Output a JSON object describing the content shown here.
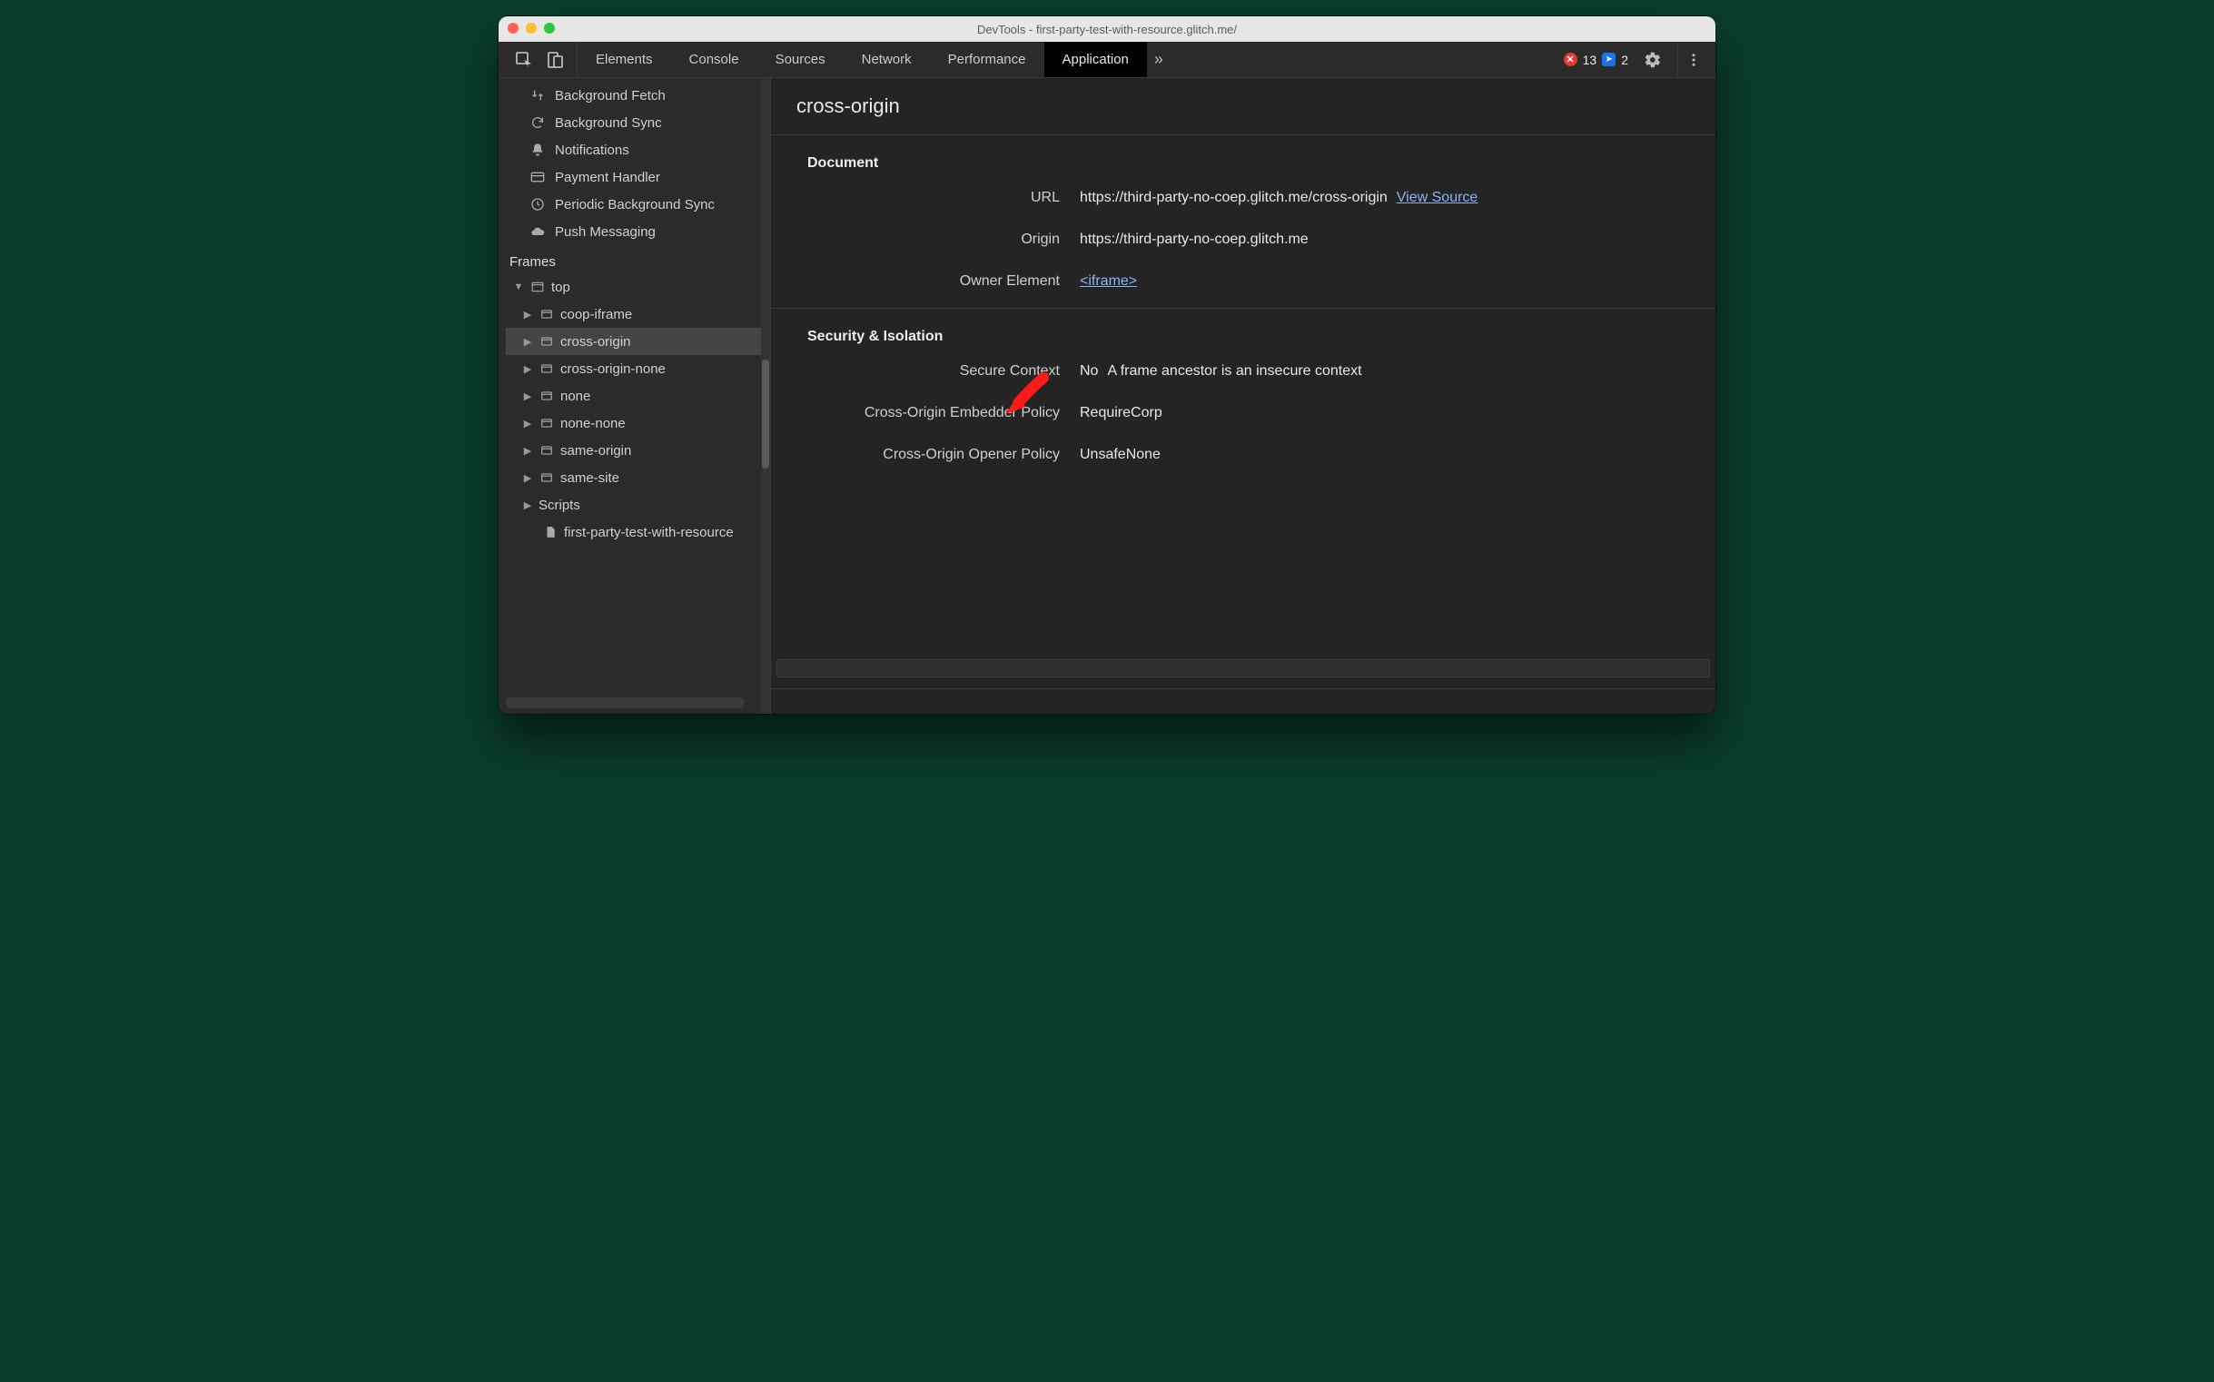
{
  "window": {
    "title": "DevTools - first-party-test-with-resource.glitch.me/"
  },
  "toolbar": {
    "tabs": [
      "Elements",
      "Console",
      "Sources",
      "Network",
      "Performance",
      "Application"
    ],
    "active_tab_index": 5,
    "more_glyph": "»",
    "error_count": "13",
    "info_count": "2"
  },
  "sidebar": {
    "bg_items": [
      {
        "icon": "swap",
        "label": "Background Fetch"
      },
      {
        "icon": "sync",
        "label": "Background Sync"
      },
      {
        "icon": "bell",
        "label": "Notifications"
      },
      {
        "icon": "card",
        "label": "Payment Handler"
      },
      {
        "icon": "clock",
        "label": "Periodic Background Sync"
      },
      {
        "icon": "cloud",
        "label": "Push Messaging"
      }
    ],
    "frames_title": "Frames",
    "tree": {
      "top_label": "top",
      "children": [
        {
          "label": "coop-iframe"
        },
        {
          "label": "cross-origin",
          "selected": true
        },
        {
          "label": "cross-origin-none"
        },
        {
          "label": "none"
        },
        {
          "label": "none-none"
        },
        {
          "label": "same-origin"
        },
        {
          "label": "same-site"
        }
      ],
      "scripts_label": "Scripts",
      "file_label": "first-party-test-with-resource"
    }
  },
  "main": {
    "page_title": "cross-origin",
    "sections": [
      {
        "title": "Document",
        "rows": [
          {
            "k": "URL",
            "v": "https://third-party-no-coep.glitch.me/cross-origin",
            "link": "View Source"
          },
          {
            "k": "Origin",
            "v": "https://third-party-no-coep.glitch.me"
          },
          {
            "k": "Owner Element",
            "vlink": "<iframe>"
          }
        ]
      },
      {
        "title": "Security & Isolation",
        "rows": [
          {
            "k": "Secure Context",
            "v": "No",
            "extra": "A frame ancestor is an insecure context"
          },
          {
            "k": "Cross-Origin Embedder Policy",
            "v": "RequireCorp"
          },
          {
            "k": "Cross-Origin Opener Policy",
            "v": "UnsafeNone"
          }
        ]
      }
    ]
  }
}
